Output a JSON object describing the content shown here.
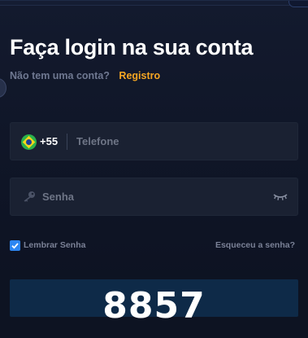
{
  "login": {
    "title": "Faça login na sua conta",
    "no_account_text": "Não tem uma conta?",
    "register_link": "Registro"
  },
  "phone": {
    "country_flag": "brazil-flag-icon",
    "country_code": "+55",
    "placeholder": "Telefone",
    "value": ""
  },
  "password": {
    "icon": "key-icon",
    "placeholder": "Senha",
    "value": "",
    "toggle_icon": "eye-closed-icon"
  },
  "options": {
    "remember_label": "Lembrar Senha",
    "remember_checked": true,
    "forgot_link": "Esqueceu a senha?"
  },
  "captcha": {
    "code": "8857"
  },
  "colors": {
    "background": "#131a2e",
    "field": "#1a2132",
    "accent": "#f5a623",
    "checkbox": "#2d86f2",
    "captcha_bg": "#0e2a48"
  }
}
